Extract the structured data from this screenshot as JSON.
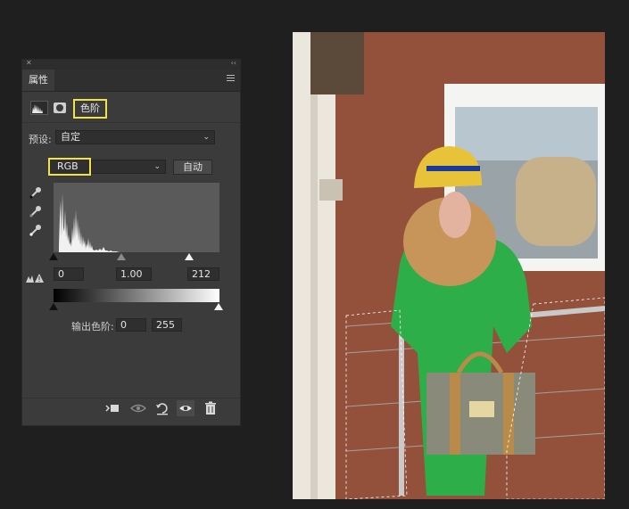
{
  "panel": {
    "tab_label": "属性",
    "adjustment_title": "色阶",
    "preset_label": "预设:",
    "preset_value": "自定",
    "channel_value": "RGB",
    "auto_label": "自动",
    "input_levels": {
      "black": "0",
      "gamma": "1.00",
      "white": "212"
    },
    "output_label": "输出色阶:",
    "output_levels": {
      "black": "0",
      "white": "255"
    },
    "icons": {
      "panel_close": "close-icon",
      "panel_collapse": "collapse-icon",
      "panel_menu": "hamburger-menu-icon",
      "adjustment": "levels-histogram-icon",
      "mask": "layer-mask-icon",
      "eyedroppers": [
        "black-point-eyedropper-icon",
        "gray-point-eyedropper-icon",
        "white-point-eyedropper-icon"
      ],
      "clipping_warning": "clipping-warning-icon",
      "footer": [
        "clip-to-layer-icon",
        "view-previous-state-icon",
        "reset-icon",
        "visibility-eye-icon",
        "trash-icon"
      ]
    }
  },
  "colors": {
    "highlight_box": "#f2e24a",
    "panel_bg": "#3b3b3b",
    "app_bg": "#1f1f1f"
  }
}
